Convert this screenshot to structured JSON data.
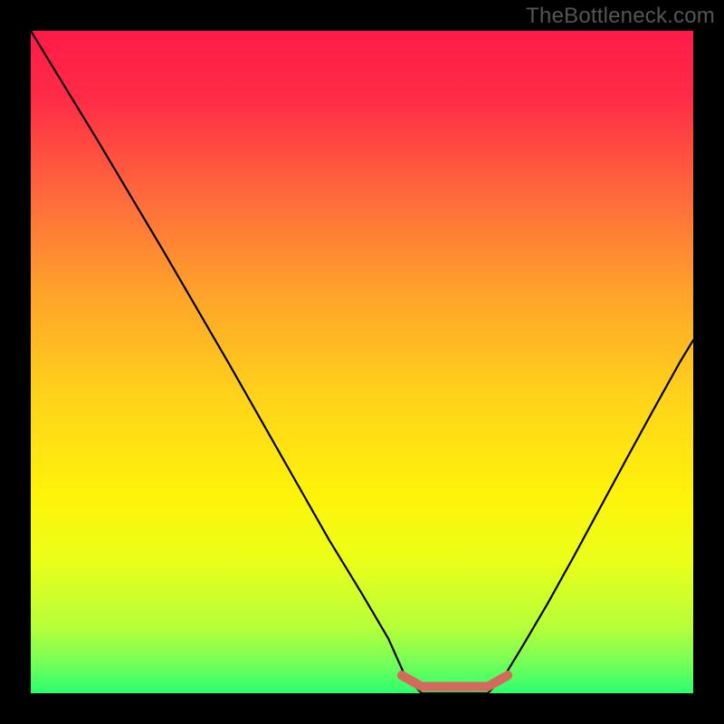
{
  "watermark": "TheBottleneck.com",
  "chart_data": {
    "type": "line",
    "title": "",
    "xlabel": "",
    "ylabel": "",
    "xlim": [
      0,
      1
    ],
    "ylim": [
      0,
      1
    ],
    "background_gradient_stops": [
      {
        "offset": 0.0,
        "color": "#ff1b47"
      },
      {
        "offset": 0.1,
        "color": "#ff2b46"
      },
      {
        "offset": 0.25,
        "color": "#ff6a3c"
      },
      {
        "offset": 0.4,
        "color": "#ffa42a"
      },
      {
        "offset": 0.55,
        "color": "#ffd21b"
      },
      {
        "offset": 0.7,
        "color": "#fff30a"
      },
      {
        "offset": 0.8,
        "color": "#eaff19"
      },
      {
        "offset": 0.9,
        "color": "#b6ff3a"
      },
      {
        "offset": 0.95,
        "color": "#7bff55"
      },
      {
        "offset": 1.0,
        "color": "#2bff6e"
      }
    ],
    "curve": {
      "name": "bottleneck-curve",
      "color": "#000000",
      "points": [
        {
          "x": 0.0,
          "y": 1.0
        },
        {
          "x": 0.05,
          "y": 0.918
        },
        {
          "x": 0.1,
          "y": 0.836
        },
        {
          "x": 0.15,
          "y": 0.752
        },
        {
          "x": 0.2,
          "y": 0.668
        },
        {
          "x": 0.25,
          "y": 0.582
        },
        {
          "x": 0.3,
          "y": 0.496
        },
        {
          "x": 0.35,
          "y": 0.408
        },
        {
          "x": 0.4,
          "y": 0.32
        },
        {
          "x": 0.45,
          "y": 0.232
        },
        {
          "x": 0.5,
          "y": 0.15
        },
        {
          "x": 0.54,
          "y": 0.082
        },
        {
          "x": 0.565,
          "y": 0.026
        },
        {
          "x": 0.59,
          "y": 0.0
        },
        {
          "x": 0.64,
          "y": 0.0
        },
        {
          "x": 0.69,
          "y": 0.0
        },
        {
          "x": 0.715,
          "y": 0.026
        },
        {
          "x": 0.74,
          "y": 0.067
        },
        {
          "x": 0.78,
          "y": 0.135
        },
        {
          "x": 0.82,
          "y": 0.207
        },
        {
          "x": 0.86,
          "y": 0.281
        },
        {
          "x": 0.9,
          "y": 0.355
        },
        {
          "x": 0.94,
          "y": 0.428
        },
        {
          "x": 0.98,
          "y": 0.5
        },
        {
          "x": 1.0,
          "y": 0.533
        }
      ]
    },
    "flat_marker": {
      "name": "optimal-range-marker",
      "color": "#d46a5e",
      "points": [
        {
          "x": 0.56,
          "y": 0.027
        },
        {
          "x": 0.59,
          "y": 0.01
        },
        {
          "x": 0.69,
          "y": 0.01
        },
        {
          "x": 0.72,
          "y": 0.027
        }
      ]
    }
  }
}
